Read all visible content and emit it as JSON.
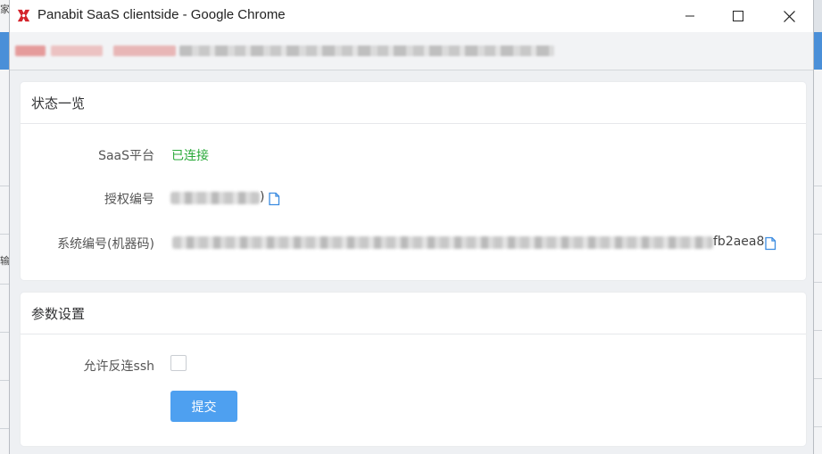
{
  "window": {
    "title": "Panabit SaaS clientside - Google Chrome"
  },
  "background": {
    "left_glyph": "家",
    "left_glyph2": "输"
  },
  "status_card": {
    "title": "状态一览",
    "saas_label": "SaaS平台",
    "saas_status": "已连接",
    "license_label": "授权编号",
    "license_suffix": ")",
    "system_label": "系统编号(机器码)",
    "system_suffix": "fb2aea8"
  },
  "params_card": {
    "title": "参数设置",
    "ssh_label": "允许反连ssh",
    "ssh_checked": false,
    "submit_label": "提交"
  },
  "colors": {
    "status_ok": "#2aaa3a",
    "primary": "#4ea0f0",
    "icon_blue": "#3b8be0"
  },
  "icons": {
    "copy": "copy-icon",
    "minimize": "minimize-icon",
    "maximize": "maximize-icon",
    "close": "close-icon"
  }
}
